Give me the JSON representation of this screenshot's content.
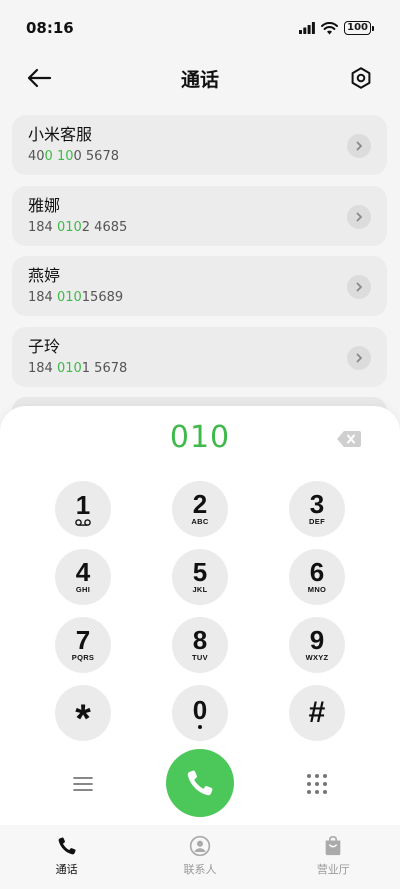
{
  "status_bar": {
    "time": "08:16",
    "battery": "100"
  },
  "header": {
    "title": "通话"
  },
  "contacts": [
    {
      "name": "小米客服",
      "number_parts": [
        "40",
        "0 10",
        "0 5678"
      ]
    },
    {
      "name": "雅娜",
      "number_parts": [
        "184 ",
        "010",
        "2 4685"
      ]
    },
    {
      "name": "燕婷",
      "number_parts": [
        "184 ",
        "010",
        "15689"
      ]
    },
    {
      "name": "子玲",
      "number_parts": [
        "184 ",
        "010",
        "1 5678"
      ]
    }
  ],
  "dialer": {
    "dialed": "010",
    "keys": [
      {
        "digit": "1",
        "letters": ""
      },
      {
        "digit": "2",
        "letters": "ABC"
      },
      {
        "digit": "3",
        "letters": "DEF"
      },
      {
        "digit": "4",
        "letters": "GHI"
      },
      {
        "digit": "5",
        "letters": "JKL"
      },
      {
        "digit": "6",
        "letters": "MNO"
      },
      {
        "digit": "7",
        "letters": "PQRS"
      },
      {
        "digit": "8",
        "letters": "TUV"
      },
      {
        "digit": "9",
        "letters": "WXYZ"
      },
      {
        "digit": "*",
        "letters": ""
      },
      {
        "digit": "0",
        "letters": ""
      },
      {
        "digit": "#",
        "letters": ""
      }
    ]
  },
  "bottom_nav": [
    {
      "label": "通话",
      "icon": "phone-icon",
      "active": true
    },
    {
      "label": "联系人",
      "icon": "contact-icon",
      "active": false
    },
    {
      "label": "营业厅",
      "icon": "store-icon",
      "active": false
    }
  ],
  "colors": {
    "accent": "#3fb94a",
    "call_button": "#4cc85a",
    "card_bg": "#ececec",
    "key_bg": "#ebebeb"
  }
}
